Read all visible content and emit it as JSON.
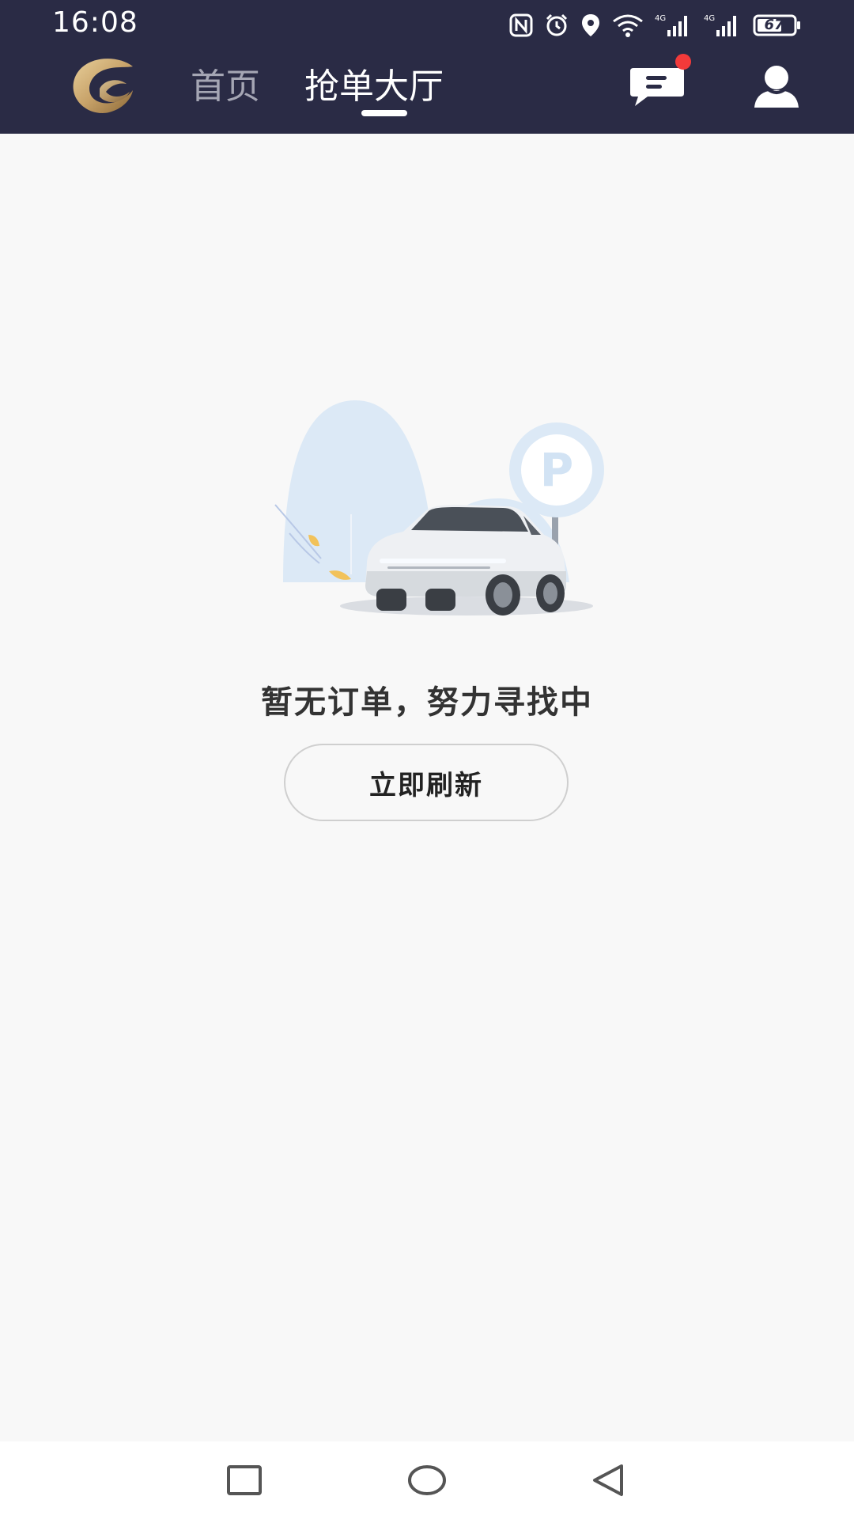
{
  "status_bar": {
    "time": "16:08",
    "battery": "67",
    "icons": [
      "nfc-icon",
      "alarm-icon",
      "location-icon",
      "wifi-icon",
      "signal-4g-icon",
      "signal-4g-icon",
      "battery-icon"
    ]
  },
  "header": {
    "logo": "brand-logo",
    "tabs": [
      {
        "label": "首页",
        "active": false
      },
      {
        "label": "抢单大厅",
        "active": true
      }
    ],
    "message_icon": "message-icon",
    "profile_icon": "user-icon"
  },
  "empty_state": {
    "illustration": "parked-car-illustration",
    "message": "暂无订单，努力寻找中",
    "refresh_label": "立即刷新"
  },
  "system_nav": {
    "buttons": [
      "recent-apps-icon",
      "home-icon",
      "back-icon"
    ]
  },
  "colors": {
    "header_bg": "#2a2b45",
    "page_bg": "#f8f8f8",
    "badge": "#f23a3a",
    "logo_gold": "#c8a36a"
  }
}
